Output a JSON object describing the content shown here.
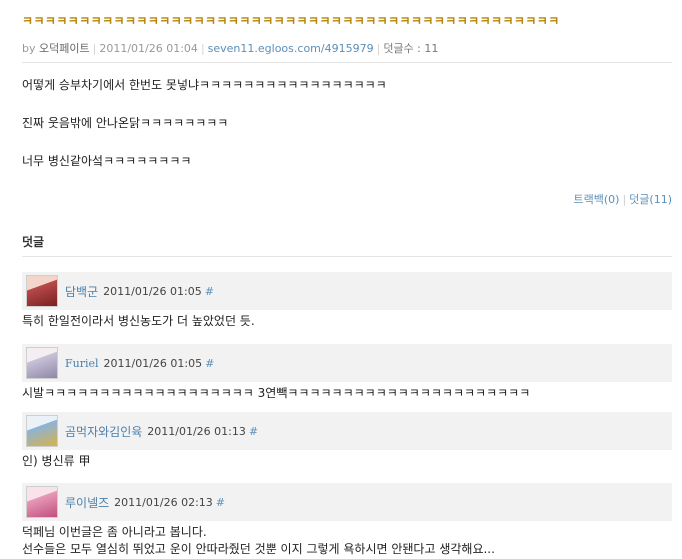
{
  "post": {
    "title": "ㅋㅋㅋㅋㅋㅋㅋㅋㅋㅋㅋㅋㅋㅋㅋㅋㅋㅋㅋㅋㅋㅋㅋㅋㅋㅋㅋㅋㅋㅋㅋㅋㅋㅋㅋㅋㅋㅋㅋㅋㅋㅋㅋㅋㅋㅋㅋ",
    "meta": {
      "by_label": "by",
      "author": "오덕페이트",
      "date": "2011/01/26 01:04",
      "url": "seven11.egloos.com/4915979",
      "comment_count_label": "덧글수 : 11"
    },
    "paragraphs": [
      "어떻게 승부차기에서 한번도 못넣냐ㅋㅋㅋㅋㅋㅋㅋㅋㅋㅋㅋㅋㅋㅋㅋㅋㅋ",
      "진짜 웃음밖에 안나온닭ㅋㅋㅋㅋㅋㅋㅋㅋ",
      "너무 병신같아섴ㅋㅋㅋㅋㅋㅋㅋㅋ"
    ],
    "trackback_label": "트랙백",
    "trackback_count": "(0)",
    "comment_label": "덧글",
    "comment_count": "(11)"
  },
  "comments_header": "덧글",
  "comments": [
    {
      "author": "담백군",
      "date": "2011/01/26 01:05",
      "anchor": "#",
      "lines": [
        "특히 한일전이라서 병신농도가 더 높았었던 듯."
      ],
      "avatar_color": "#b84a4a",
      "avatar_icon": "red-haired-anime-avatar"
    },
    {
      "author": "Furiel",
      "date": "2011/01/26 01:05",
      "anchor": "#",
      "lines": [
        "시발ㅋㅋㅋㅋㅋㅋㅋㅋㅋㅋㅋㅋㅋㅋㅋㅋㅋㅋㅋ 3연빽ㅋㅋㅋㅋㅋㅋㅋㅋㅋㅋㅋㅋㅋㅋㅋㅋㅋㅋㅋㅋㅋㅋ"
      ],
      "avatar_color": "#c9c3d8",
      "avatar_icon": "silver-haired-anime-avatar"
    },
    {
      "author": "곰먹자와김인육",
      "date": "2011/01/26 01:13",
      "anchor": "#",
      "lines": [
        "인) 병신류 甲"
      ],
      "avatar_color": "#8bb3d9",
      "avatar_icon": "blue-anime-avatar"
    },
    {
      "author": "루이넬즈",
      "date": "2011/01/26 02:13",
      "anchor": "#",
      "lines": [
        "덕페님 이번글은 좀 아니라고 봅니다.",
        "선수들은 모두 열심히 뛰었고 운이 안따라줬던 것뿐 이지 그렇게 욕하시면 안됀다고 생각해요..."
      ],
      "avatar_color": "#e79ab8",
      "avatar_icon": "pink-haired-anime-avatar"
    }
  ]
}
